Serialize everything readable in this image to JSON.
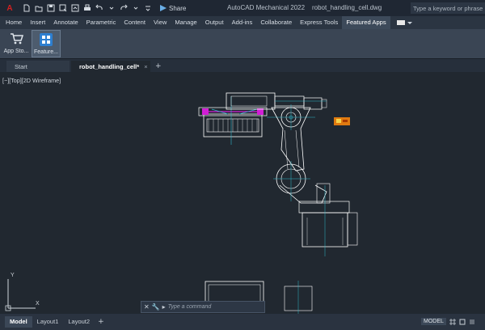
{
  "titlebar": {
    "logo_text": "A",
    "share_label": "Share",
    "app_title": "AutoCAD Mechanical 2022",
    "document_name": "robot_handling_cell.dwg",
    "search_placeholder": "Type a keyword or phrase"
  },
  "ribbon": {
    "tabs": [
      {
        "label": "Home"
      },
      {
        "label": "Insert"
      },
      {
        "label": "Annotate"
      },
      {
        "label": "Parametric"
      },
      {
        "label": "Content"
      },
      {
        "label": "View"
      },
      {
        "label": "Manage"
      },
      {
        "label": "Output"
      },
      {
        "label": "Add-ins"
      },
      {
        "label": "Collaborate"
      },
      {
        "label": "Express Tools"
      },
      {
        "label": "Featured Apps"
      }
    ],
    "active_tab": "Featured Apps",
    "buttons": [
      {
        "label": "App Sto...",
        "icon": "shopping-cart-icon"
      },
      {
        "label": "Feature...",
        "icon": "featured-apps-icon"
      }
    ]
  },
  "file_tabs": {
    "start_label": "Start",
    "active_label": "robot_handling_cell*",
    "close_glyph": "×",
    "add_glyph": "+"
  },
  "viewport": {
    "label": "[−][Top][2D Wireframe]",
    "ucs_y": "Y",
    "ucs_x": "X"
  },
  "command_line": {
    "placeholder": "Type a command"
  },
  "status_bar": {
    "layout_tabs": [
      {
        "label": "Model"
      },
      {
        "label": "Layout1"
      },
      {
        "label": "Layout2"
      }
    ],
    "active_layout": "Model",
    "add_glyph": "+",
    "space_label": "MODEL"
  },
  "colors": {
    "canvas_bg": "#212830",
    "linework": "#ffffff",
    "accent_cyan": "#2fb6c9",
    "accent_magenta": "#d21fd6",
    "accent_orange": "#e07a10"
  }
}
